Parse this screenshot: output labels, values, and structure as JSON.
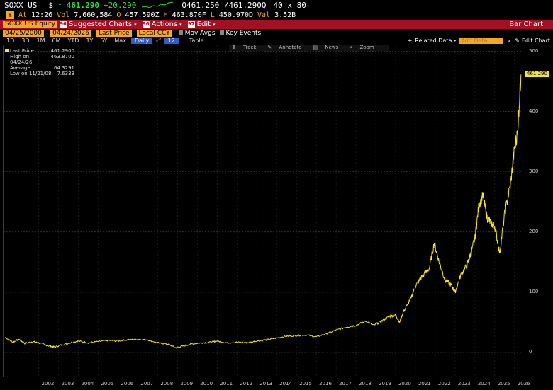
{
  "ticker": {
    "symbol": "SOXX US",
    "currency_icon": "$",
    "arrow_icon": "↑",
    "last_price": "461.290",
    "change": "+20.290",
    "bid_ask": "Q461.250 /461.290Q",
    "size": "40 x 80"
  },
  "quote": {
    "at_label": "At",
    "time": "12:26",
    "vol_label": "Vol",
    "volume": "7,660,584",
    "open_label": "O",
    "open": "457.590Z",
    "high_label": "H",
    "high": "463.870F",
    "low_label": "L",
    "low": "450.970D",
    "val_label": "Val",
    "value": "3.52B"
  },
  "func_bar": {
    "security": "SOXX US Equity",
    "suggested": "Suggested Charts",
    "actions": "Actions",
    "edit": "Edit",
    "function_name": "Bar Chart"
  },
  "params": {
    "start_date": "04/25/2000",
    "dash": "-",
    "end_date": "04/24/2026",
    "last_price": "Last Price",
    "currency": "Local CCY",
    "mov_avgs": "Mov Avgs",
    "key_events": "Key Events"
  },
  "range": {
    "buttons": [
      "1D",
      "3D",
      "1M",
      "6M",
      "YTD",
      "1Y",
      "5Y",
      "Max"
    ],
    "frequency": "Daily",
    "chart_type": "12",
    "table": "Table",
    "related": "Related Data",
    "add_data": "Add Data",
    "edit_chart": "Edit Chart"
  },
  "tools": [
    "Track",
    "Annotate",
    "News",
    "Zoom"
  ],
  "legend": [
    {
      "label": "Last Price",
      "value": "461.2900"
    },
    {
      "label": "High on 04/24/26",
      "value": "463.8700"
    },
    {
      "label": "Average",
      "value": "64.3291"
    },
    {
      "label": "Low on 11/21/08",
      "value": "7.6333"
    }
  ],
  "last_tag": "461.290",
  "colors": {
    "accent": "#f5a623",
    "series": "#f5e52c",
    "bar": "#a50f24"
  },
  "chart_data": {
    "type": "line",
    "series": [
      {
        "name": "Last Price",
        "x": [
          2000.3,
          2000.7,
          2001.0,
          2001.3,
          2001.7,
          2002.0,
          2002.5,
          2002.8,
          2003.2,
          2003.6,
          2004.0,
          2004.5,
          2005.0,
          2005.5,
          2006.0,
          2006.5,
          2007.0,
          2007.5,
          2008.0,
          2008.5,
          2008.9,
          2009.2,
          2009.7,
          2010.2,
          2010.7,
          2011.0,
          2011.5,
          2012.0,
          2012.5,
          2013.0,
          2013.5,
          2014.0,
          2014.5,
          2015.0,
          2015.5,
          2016.0,
          2016.5,
          2017.0,
          2017.5,
          2018.0,
          2018.5,
          2018.9,
          2019.3,
          2019.7,
          2020.0,
          2020.2,
          2020.4,
          2020.7,
          2021.0,
          2021.3,
          2021.7,
          2021.95,
          2022.2,
          2022.5,
          2022.8,
          2023.0,
          2023.3,
          2023.6,
          2023.8,
          2024.0,
          2024.2,
          2024.4,
          2024.6,
          2024.8,
          2025.0,
          2025.25,
          2025.5,
          2025.8,
          2026.0,
          2026.15,
          2026.32
        ],
        "y": [
          25,
          17,
          22,
          15,
          18,
          16,
          11,
          9,
          13,
          16,
          19,
          16,
          18,
          20,
          19,
          21,
          22,
          21,
          16,
          14,
          8,
          10,
          14,
          16,
          17,
          19,
          16,
          17,
          16,
          19,
          21,
          24,
          27,
          28,
          29,
          26,
          31,
          37,
          42,
          45,
          52,
          45,
          52,
          60,
          62,
          50,
          68,
          85,
          110,
          125,
          140,
          182,
          150,
          120,
          112,
          100,
          130,
          145,
          165,
          190,
          245,
          260,
          225,
          215,
          210,
          165,
          230,
          280,
          340,
          365,
          461.29
        ]
      }
    ],
    "xticks": [
      "2002",
      "2003",
      "2004",
      "2005",
      "2006",
      "2007",
      "2008",
      "2009",
      "2010",
      "2011",
      "2012",
      "2013",
      "2014",
      "2015",
      "2016",
      "2017",
      "2018",
      "2019",
      "2020",
      "2021",
      "2022",
      "2023",
      "2024",
      "2025",
      "2026"
    ],
    "yticks": [
      0,
      100,
      200,
      300,
      400,
      500
    ],
    "xlim": [
      2000.3,
      2026.4
    ],
    "ylim": [
      -40,
      510
    ],
    "grid": true
  }
}
